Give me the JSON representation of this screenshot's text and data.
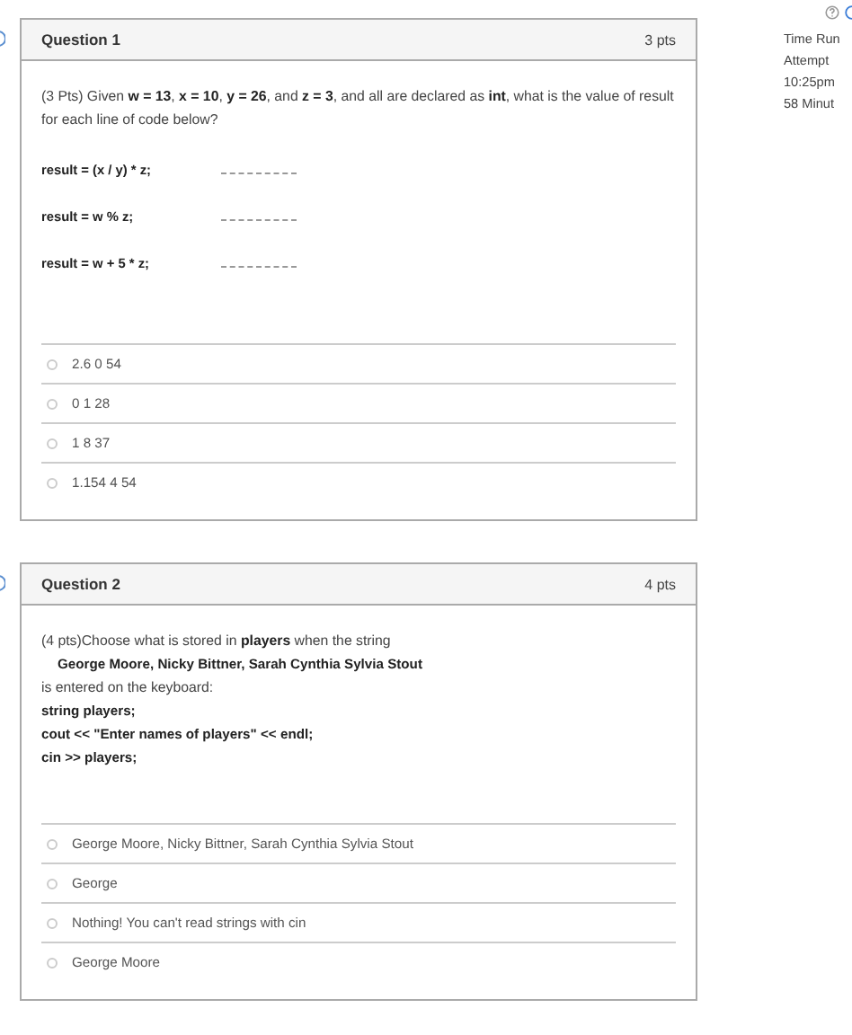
{
  "questions": [
    {
      "title": "Question 1",
      "points": "3 pts",
      "body": [
        {
          "kind": "text",
          "text": "(3 Pts) Given **w = 13**, **x = 10**, **y = 26**, and **z = 3**, and all are declared as **int**, what is the value of result for each line of code below?"
        },
        {
          "kind": "blank",
          "text": "result = (x / y) * z;"
        },
        {
          "kind": "blank",
          "text": "result = w % z;"
        },
        {
          "kind": "blank",
          "text": "result = w + 5 * z;"
        }
      ],
      "answers": [
        {
          "text": "2.6 0 54",
          "selected": false
        },
        {
          "text": "0 1 28",
          "selected": false
        },
        {
          "text": "1 8 37",
          "selected": false
        },
        {
          "text": "1.154 4 54",
          "selected": false
        }
      ]
    },
    {
      "title": "Question 2",
      "points": "4 pts",
      "body": [
        {
          "kind": "text",
          "text": "(4 pts)Choose what is stored in **players** when the string"
        },
        {
          "kind": "quote",
          "text": "George Moore, Nicky Bittner, Sarah Cynthia Sylvia Stout"
        },
        {
          "kind": "text",
          "text": "is entered on the keyboard:"
        },
        {
          "kind": "code",
          "text": "string players;"
        },
        {
          "kind": "code",
          "text": "cout << \"Enter names of players\" << endl;"
        },
        {
          "kind": "code",
          "text": "cin >> players;"
        }
      ],
      "answers": [
        {
          "text": "George Moore, Nicky Bittner, Sarah Cynthia Sylvia Stout",
          "selected": false
        },
        {
          "text": "George",
          "selected": false
        },
        {
          "text": "Nothing! You can't read strings with cin",
          "selected": false
        },
        {
          "text": "George Moore",
          "selected": false
        }
      ]
    }
  ],
  "sidebar": {
    "lines": [
      "Time Run",
      "Attempt",
      "10:25pm",
      "58 Minut"
    ]
  }
}
